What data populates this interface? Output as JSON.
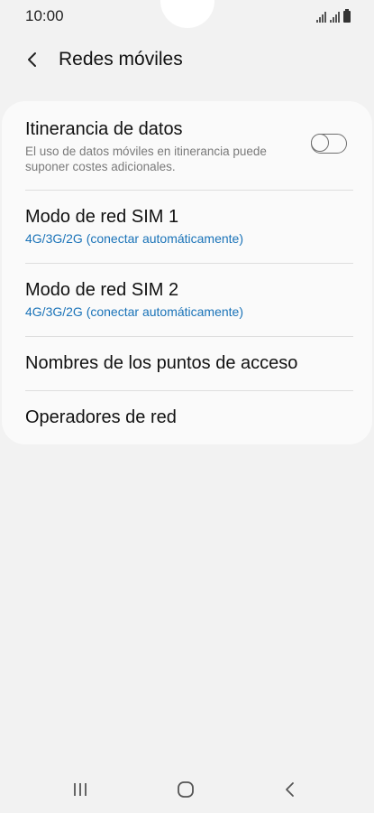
{
  "status_bar": {
    "time": "10:00"
  },
  "header": {
    "back_icon": "chevron-left-icon",
    "title": "Redes móviles"
  },
  "settings": {
    "data_roaming": {
      "title": "Itinerancia de datos",
      "description": "El uso de datos móviles en itinerancia puede suponer costes adicionales.",
      "toggle_state": "off"
    },
    "sim1_network_mode": {
      "title": "Modo de red SIM 1",
      "value": "4G/3G/2G (conectar automáticamente)"
    },
    "sim2_network_mode": {
      "title": "Modo de red SIM 2",
      "value": "4G/3G/2G (conectar automáticamente)"
    },
    "access_point_names": {
      "title": "Nombres de los puntos de acceso"
    },
    "network_operators": {
      "title": "Operadores de red"
    }
  },
  "colors": {
    "background": "#f2f2f2",
    "card": "#fafafa",
    "accent_text": "#1a73b8"
  },
  "nav_bar": {
    "icons": [
      "recent-apps-icon",
      "home-icon",
      "back-icon"
    ]
  }
}
